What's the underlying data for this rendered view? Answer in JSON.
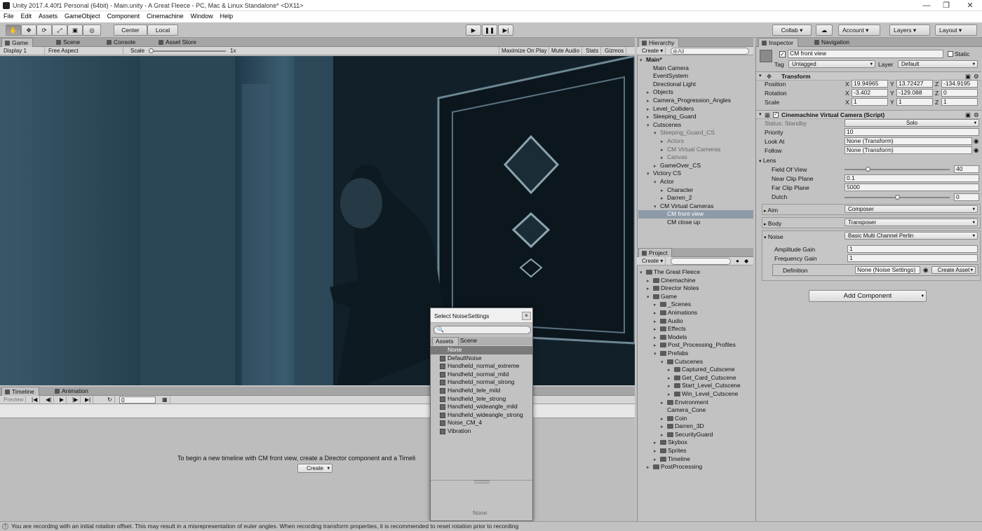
{
  "window": {
    "title": "Unity 2017.4.40f1 Personal (64bit) - Main.unity - A Great Fleece - PC, Mac & Linux Standalone* <DX11>",
    "minimize": "—",
    "maximize": "❐",
    "close": "✕"
  },
  "menu": [
    "File",
    "Edit",
    "Assets",
    "GameObject",
    "Component",
    "Cinemachine",
    "Window",
    "Help"
  ],
  "toolbar": {
    "center": "Center",
    "local": "Local",
    "collab": "Collab ▾",
    "account": "Account",
    "layers": "Layers",
    "layout": "Layout"
  },
  "game_panel": {
    "tabs": [
      "Game",
      "Scene",
      "Console",
      "Asset Store"
    ],
    "display": "Display 1",
    "aspect": "Free Aspect",
    "scale_label": "Scale",
    "scale_value": "1x",
    "buttons": [
      "Maximize On Play",
      "Mute Audio",
      "Stats",
      "Gizmos"
    ]
  },
  "hierarchy": {
    "tab": "Hierarchy",
    "create": "Create",
    "search": "⊕All",
    "rows": [
      {
        "t": "Main*",
        "d": 0,
        "exp": "▾",
        "bold": true
      },
      {
        "t": "Main Camera",
        "d": 1
      },
      {
        "t": "EventSystem",
        "d": 1
      },
      {
        "t": "Directional Light",
        "d": 1
      },
      {
        "t": "Objects",
        "d": 1,
        "exp": "▸"
      },
      {
        "t": "Camera_Progression_Angles",
        "d": 1,
        "exp": "▸"
      },
      {
        "t": "Level_Colliders",
        "d": 1,
        "exp": "▸"
      },
      {
        "t": "Sleeping_Guard",
        "d": 1,
        "exp": "▸"
      },
      {
        "t": "Cutscenes",
        "d": 1,
        "exp": "▾"
      },
      {
        "t": "Sleeping_Guard_CS",
        "d": 2,
        "exp": "▾",
        "dim": true
      },
      {
        "t": "Actors",
        "d": 3,
        "exp": "▸",
        "dim": true
      },
      {
        "t": "CM Virtual Cameras",
        "d": 3,
        "exp": "▸",
        "dim": true
      },
      {
        "t": "Canvas",
        "d": 3,
        "exp": "▸",
        "dim": true
      },
      {
        "t": "GameOver_CS",
        "d": 2,
        "exp": "▸"
      },
      {
        "t": "Victory CS",
        "d": 1,
        "exp": "▾"
      },
      {
        "t": "Actor",
        "d": 2,
        "exp": "▾"
      },
      {
        "t": "Character",
        "d": 3,
        "exp": "▸"
      },
      {
        "t": "Darren_2",
        "d": 3,
        "exp": "▸"
      },
      {
        "t": "CM Virtual Cameras",
        "d": 2,
        "exp": "▾"
      },
      {
        "t": "CM front view",
        "d": 3,
        "sel": true
      },
      {
        "t": "CM close up",
        "d": 3
      }
    ]
  },
  "project": {
    "tab": "Project",
    "create": "Create",
    "rows": [
      {
        "t": "The Great Fleece",
        "d": 0,
        "exp": "▾"
      },
      {
        "t": "Cinemachine",
        "d": 1,
        "exp": "▸"
      },
      {
        "t": "Director Notes",
        "d": 1,
        "exp": "▸"
      },
      {
        "t": "Game",
        "d": 1,
        "exp": "▾"
      },
      {
        "t": "_Scenes",
        "d": 2,
        "exp": "▸"
      },
      {
        "t": "Animations",
        "d": 2,
        "exp": "▸"
      },
      {
        "t": "Audio",
        "d": 2,
        "exp": "▸"
      },
      {
        "t": "Effects",
        "d": 2,
        "exp": "▸"
      },
      {
        "t": "Models",
        "d": 2,
        "exp": "▸"
      },
      {
        "t": "Post_Processing_Profiles",
        "d": 2,
        "exp": "▸"
      },
      {
        "t": "Prefabs",
        "d": 2,
        "exp": "▾"
      },
      {
        "t": "Cutscenes",
        "d": 3,
        "exp": "▾"
      },
      {
        "t": "Captured_Cutscene",
        "d": 4,
        "exp": "▸"
      },
      {
        "t": "Get_Card_Cutscene",
        "d": 4,
        "exp": "▸"
      },
      {
        "t": "Start_Level_Cutscene",
        "d": 4,
        "exp": "▸"
      },
      {
        "t": "Win_Level_Cutscene",
        "d": 4,
        "exp": "▸"
      },
      {
        "t": "Environment",
        "d": 3,
        "exp": "▸"
      },
      {
        "t": "Camera_Cone",
        "d": 3
      },
      {
        "t": "Coin",
        "d": 3,
        "exp": "▸"
      },
      {
        "t": "Darren_3D",
        "d": 3,
        "exp": "▸"
      },
      {
        "t": "SecurityGuard",
        "d": 3,
        "exp": "▸"
      },
      {
        "t": "Skybox",
        "d": 2,
        "exp": "▸"
      },
      {
        "t": "Sprites",
        "d": 2,
        "exp": "▸"
      },
      {
        "t": "Timeline",
        "d": 2,
        "exp": "▸"
      },
      {
        "t": "PostProcessing",
        "d": 1,
        "exp": "▸"
      }
    ]
  },
  "inspector": {
    "tabs": [
      "Inspector",
      "Navigation"
    ],
    "object_name": "CM front view",
    "static": "Static",
    "tag_label": "Tag",
    "tag": "Untagged",
    "layer_label": "Layer",
    "layer": "Default",
    "transform": {
      "title": "Transform",
      "position_label": "Position",
      "rotation_label": "Rotation",
      "scale_label": "Scale",
      "position": [
        "19.94965",
        "13.72427",
        "-134.9195"
      ],
      "rotation": [
        "-3.402",
        "-129.088",
        "0"
      ],
      "scale": [
        "1",
        "1",
        "1"
      ]
    },
    "vcam": {
      "title": "Cinemachine Virtual Camera (Script)",
      "status": "Status: Standby",
      "solo": "Solo",
      "priority_label": "Priority",
      "priority": "10",
      "lookat_label": "Look At",
      "lookat": "None (Transform)",
      "follow_label": "Follow",
      "follow": "None (Transform)",
      "lens_label": "Lens",
      "fov_label": "Field Of View",
      "fov": "40",
      "fov_fraction": 0.22,
      "near_label": "Near Clip Plane",
      "near": "0.1",
      "far_label": "Far Clip Plane",
      "far": "5000",
      "dutch_label": "Dutch",
      "dutch": "0",
      "dutch_fraction": 0.5,
      "aim_label": "Aim",
      "aim": "Composer",
      "body_label": "Body",
      "body": "Transposer",
      "noise_label": "Noise",
      "noise": "Basic Multi Channel Perlin",
      "amp_label": "Amplitude Gain",
      "amp": "1",
      "freq_label": "Frequency Gain",
      "freq": "1",
      "def_label": "Definition",
      "def": "None (Noise Settings)",
      "create_asset": "Create Asset"
    },
    "add_component": "Add Component"
  },
  "timeline": {
    "tabs": [
      "Timeline",
      "Animation"
    ],
    "preview": "Preview",
    "frame": "0",
    "message": "To begin a new timeline with CM front view, create a Director component and a Timeli",
    "create": "Create"
  },
  "popup": {
    "title": "Select NoiseSettings",
    "tabs": [
      "Assets",
      "Scene"
    ],
    "items": [
      "None",
      "DefaultNoise",
      "Handheld_normal_extreme",
      "Handheld_normal_mild",
      "Handheld_normal_strong",
      "Handheld_tele_mild",
      "Handheld_tele_strong",
      "Handheld_wideangle_mild",
      "Handheld_wideangle_strong",
      "Noise_CM_4",
      "Vibration"
    ],
    "footer": "None"
  },
  "status": "You are recording with an initial rotation offset. This may result in a misrepresentation of euler angles. When recording transform properties, it is recommended to reset rotation prior to recording"
}
